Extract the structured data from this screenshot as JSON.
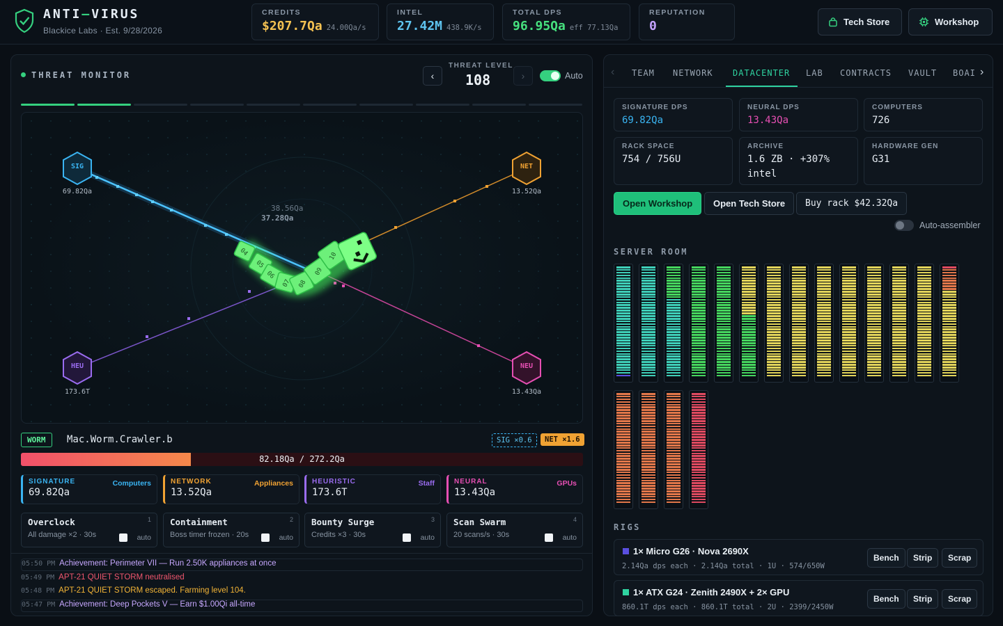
{
  "header": {
    "title_a": "ANTI",
    "title_dash": "—",
    "title_b": "VIRUS",
    "subtitle": "Blackice Labs · Est. 9/28/2026",
    "stats": [
      {
        "label": "CREDITS",
        "value": "$207.7Qa",
        "sub": "24.00Qa/s",
        "color": "#f5c252"
      },
      {
        "label": "INTEL",
        "value": "27.42M",
        "sub": "438.9K/s",
        "color": "#5ec4f0"
      },
      {
        "label": "TOTAL DPS",
        "value": "96.95Qa",
        "sub": "eff 77.13Qa",
        "color": "#46e07e"
      },
      {
        "label": "REPUTATION",
        "value": "0",
        "sub": "",
        "color": "#c5a2ff"
      }
    ],
    "tech_store": "Tech Store",
    "workshop": "Workshop"
  },
  "threat": {
    "title": "THREAT MONITOR",
    "level_label": "THREAT LEVEL",
    "level": "108",
    "auto_label": "Auto",
    "auto_on": true,
    "progress_segments_done": 2,
    "progress_segments_total": 10,
    "nodes": [
      {
        "code": "SIG",
        "value": "69.82Qa",
        "color": "#3ab4f2"
      },
      {
        "code": "NET",
        "value": "13.52Qa",
        "color": "#f0a233"
      },
      {
        "code": "HEU",
        "value": "173.6T",
        "color": "#9a6cf0"
      },
      {
        "code": "NEU",
        "value": "13.43Qa",
        "color": "#e64fb3"
      }
    ],
    "float_damage": [
      "38.56Qa",
      "37.28Qa"
    ],
    "worm_segments": [
      "04",
      "05",
      "06",
      "07",
      "08",
      "09",
      "10"
    ]
  },
  "worm": {
    "tag": "WORM",
    "name": "Mac.Worm.Crawler.b",
    "sig_mult": "SIG ×0.6",
    "net_mult": "NET ×1.6",
    "hp_text": "82.18Qa / 272.2Qa",
    "hp_fraction": 0.302
  },
  "damage": [
    {
      "key": "SIGNATURE",
      "source": "Computers",
      "value": "69.82Qa",
      "color": "#3ab4f2"
    },
    {
      "key": "NETWORK",
      "source": "Appliances",
      "value": "13.52Qa",
      "color": "#f0a233"
    },
    {
      "key": "HEURISTIC",
      "source": "Staff",
      "value": "173.6T",
      "color": "#9a6cf0"
    },
    {
      "key": "NEURAL",
      "source": "GPUs",
      "value": "13.43Qa",
      "color": "#e64fb3"
    }
  ],
  "abilities": [
    {
      "name": "Overclock",
      "num": "1",
      "desc": "All damage ×2 · 30s",
      "auto": "auto"
    },
    {
      "name": "Containment",
      "num": "2",
      "desc": "Boss timer frozen · 20s",
      "auto": "auto"
    },
    {
      "name": "Bounty Surge",
      "num": "3",
      "desc": "Credits ×3 · 30s",
      "auto": "auto"
    },
    {
      "name": "Scan Swarm",
      "num": "4",
      "desc": "20 scans/s · 30s",
      "auto": "auto"
    }
  ],
  "log": [
    {
      "time": "05:50 PM",
      "text": "Achievement: Perimeter VII — Run 2.50K appliances at once",
      "color": "#c7a8ff"
    },
    {
      "time": "05:49 PM",
      "text": "APT-21 QUIET STORM neutralised",
      "color": "#f0566e"
    },
    {
      "time": "05:48 PM",
      "text": "APT-21 QUIET STORM escaped. Farming level 104.",
      "color": "#f3b436"
    },
    {
      "time": "05:47 PM",
      "text": "Achievement: Deep Pockets V — Earn $1.00Qi all-time",
      "color": "#c7a8ff"
    }
  ],
  "tabs": [
    "TEAM",
    "NETWORK",
    "DATACENTER",
    "LAB",
    "CONTRACTS",
    "VAULT",
    "BOAI"
  ],
  "active_tab": "DATACENTER",
  "datacenter": {
    "cards": [
      {
        "label": "SIGNATURE DPS",
        "value": "69.82Qa",
        "color": "#3ab4f2"
      },
      {
        "label": "NEURAL DPS",
        "value": "13.43Qa",
        "color": "#e64fb3"
      },
      {
        "label": "COMPUTERS",
        "value": "726",
        "color": "#e6ecf3"
      },
      {
        "label": "RACK SPACE",
        "value": "754 / 756U",
        "color": "#e6ecf3"
      },
      {
        "label": "ARCHIVE",
        "value": "1.6 ZB · +307% intel",
        "color": "#e6ecf3"
      },
      {
        "label": "HARDWARE GEN",
        "value": "G31",
        "color": "#e6ecf3"
      }
    ],
    "open_workshop": "Open Workshop",
    "open_tech_store": "Open Tech Store",
    "buy_rack": "Buy rack $42.32Qa",
    "auto_assembler": "Auto-assembler",
    "auto_assembler_on": false,
    "server_room_label": "SERVER ROOM",
    "rigs_label": "RIGS",
    "rigs": [
      {
        "name": "1× Micro G26 · Nova 2690X",
        "detail": "2.14Qa dps each · 2.14Qa total · 1U · 574/650W",
        "color": "#5a4fe0"
      },
      {
        "name": "1× ATX G24 · Zenith 2490X + 2× GPU",
        "detail": "860.1T dps each · 860.1T total · 2U · 2399/2450W",
        "color": "#2fd3a0"
      }
    ],
    "rig_buttons": [
      "Bench",
      "Strip",
      "Scrap"
    ]
  }
}
